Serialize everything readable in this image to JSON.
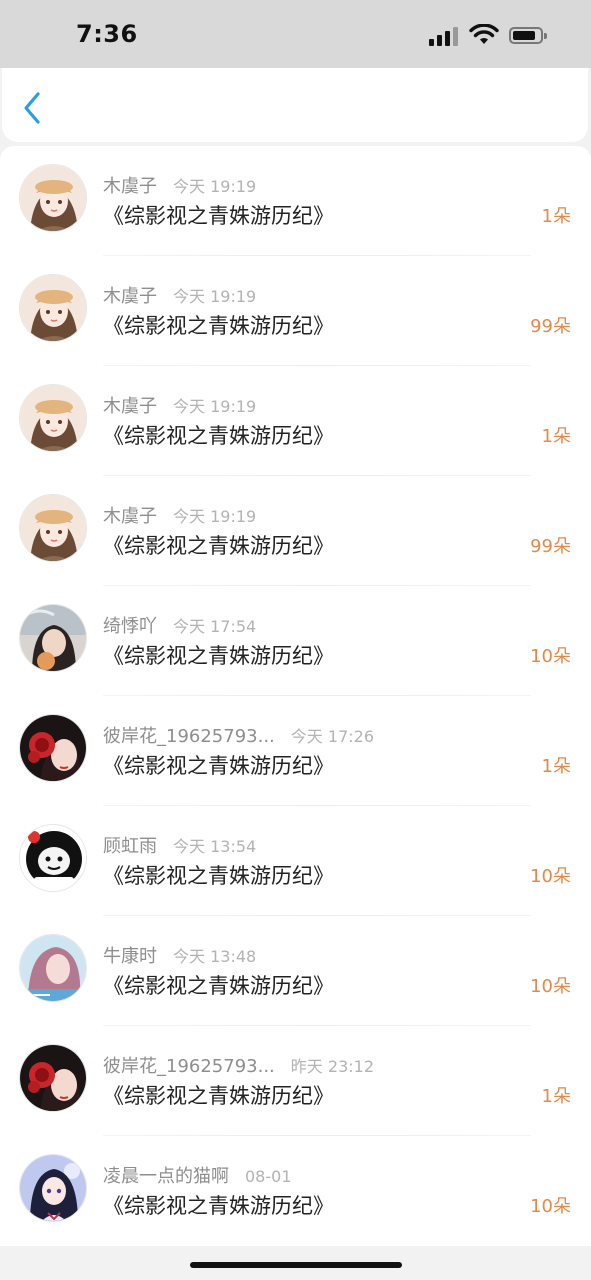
{
  "status_bar": {
    "time": "7:36"
  },
  "nav": {
    "back_icon": "chevron-left-icon",
    "accent": "#2a9fe0"
  },
  "colors": {
    "count": "#e38a4a",
    "username": "#8e8e8e",
    "time": "#b3b3b3",
    "title": "#222222"
  },
  "records": [
    {
      "username": "木虞子",
      "time": "今天 19:19",
      "book": "《综影视之青姝游历纪》",
      "count": "1朵",
      "avatar": "girl-hat"
    },
    {
      "username": "木虞子",
      "time": "今天 19:19",
      "book": "《综影视之青姝游历纪》",
      "count": "99朵",
      "avatar": "girl-hat"
    },
    {
      "username": "木虞子",
      "time": "今天 19:19",
      "book": "《综影视之青姝游历纪》",
      "count": "1朵",
      "avatar": "girl-hat"
    },
    {
      "username": "木虞子",
      "time": "今天 19:19",
      "book": "《综影视之青姝游历纪》",
      "count": "99朵",
      "avatar": "girl-hat"
    },
    {
      "username": "绮悸吖",
      "time": "今天 17:54",
      "book": "《综影视之青姝游历纪》",
      "count": "10朵",
      "avatar": "girl-photo"
    },
    {
      "username": "彼岸花_19625793...",
      "time": "今天 17:26",
      "book": "《综影视之青姝游历纪》",
      "count": "1朵",
      "avatar": "red-flower-girl"
    },
    {
      "username": "顾虹雨",
      "time": "今天 13:54",
      "book": "《综影视之青姝游历纪》",
      "count": "10朵",
      "avatar": "panda-meme"
    },
    {
      "username": "牛康时",
      "time": "今天 13:48",
      "book": "《综影视之青姝游历纪》",
      "count": "10朵",
      "avatar": "pink-hair-girl"
    },
    {
      "username": "彼岸花_19625793...",
      "time": "昨天 23:12",
      "book": "《综影视之青姝游历纪》",
      "count": "1朵",
      "avatar": "red-flower-girl"
    },
    {
      "username": "凌晨一点的猫啊",
      "time": "08-01",
      "book": "《综影视之青姝游历纪》",
      "count": "10朵",
      "avatar": "anime-girl"
    }
  ]
}
